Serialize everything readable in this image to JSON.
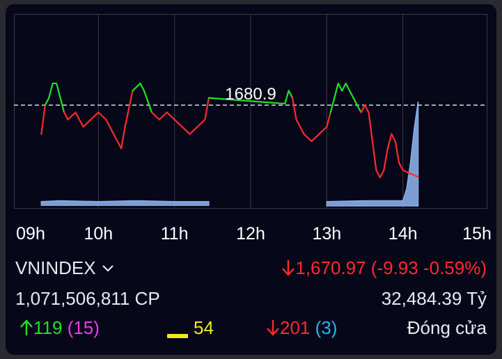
{
  "chart_data": {
    "type": "line",
    "reference_label": "1680.9",
    "reference_value": 1680.9,
    "x_tick_labels": [
      "09h",
      "10h",
      "11h",
      "12h",
      "13h",
      "14h",
      "15h"
    ],
    "series": [
      {
        "values": [
          [
            0.25,
            -4
          ],
          [
            0.3,
            0
          ],
          [
            0.35,
            1
          ],
          [
            0.4,
            3
          ],
          [
            0.45,
            3
          ],
          [
            0.5,
            1
          ],
          [
            0.55,
            -1
          ],
          [
            0.6,
            -2
          ],
          [
            0.7,
            -1
          ],
          [
            0.8,
            -3
          ],
          [
            0.9,
            -2
          ],
          [
            1.0,
            -1
          ],
          [
            1.1,
            -2
          ],
          [
            1.2,
            -4
          ],
          [
            1.3,
            -6
          ],
          [
            1.35,
            -3
          ],
          [
            1.45,
            2
          ],
          [
            1.55,
            3
          ],
          [
            1.6,
            2
          ],
          [
            1.7,
            -1
          ],
          [
            1.8,
            -2
          ],
          [
            1.9,
            -1
          ],
          [
            2.0,
            -2
          ],
          [
            2.1,
            -3
          ],
          [
            2.2,
            -4
          ],
          [
            2.3,
            -3
          ],
          [
            2.4,
            -2
          ],
          [
            2.45,
            1
          ],
          [
            3.45,
            0.2
          ],
          [
            3.5,
            2
          ],
          [
            3.55,
            1
          ],
          [
            3.6,
            -2
          ],
          [
            3.7,
            -4
          ],
          [
            3.8,
            -5
          ],
          [
            3.9,
            -4
          ],
          [
            4.0,
            -3
          ],
          [
            4.05,
            -1
          ],
          [
            4.15,
            3
          ],
          [
            4.2,
            2
          ],
          [
            4.25,
            3
          ],
          [
            4.35,
            1
          ],
          [
            4.45,
            -1
          ],
          [
            4.5,
            0
          ],
          [
            4.55,
            -1
          ],
          [
            4.6,
            -5
          ],
          [
            4.65,
            -9
          ],
          [
            4.7,
            -10
          ],
          [
            4.75,
            -9
          ],
          [
            4.8,
            -6
          ],
          [
            4.85,
            -4
          ],
          [
            4.9,
            -5
          ],
          [
            4.95,
            -8
          ],
          [
            5.0,
            -9
          ],
          [
            5.1,
            -9.5
          ],
          [
            5.2,
            -9.93
          ]
        ]
      }
    ],
    "volume": [
      [
        0.25,
        0.5
      ],
      [
        0.5,
        0.6
      ],
      [
        1.0,
        0.5
      ],
      [
        1.5,
        0.6
      ],
      [
        2.0,
        0.5
      ],
      [
        2.45,
        0.5
      ],
      [
        4.0,
        0.5
      ],
      [
        4.5,
        0.6
      ],
      [
        5.0,
        0.6
      ],
      [
        5.05,
        2
      ],
      [
        5.1,
        5
      ],
      [
        5.15,
        9
      ],
      [
        5.2,
        12
      ]
    ]
  },
  "footer": {
    "index_name": "VNINDEX",
    "index_value": "1,670.97 (-9.93 -0.59%)",
    "volume": "1,071,506,811 CP",
    "value": "32,484.39 Tỷ",
    "advances": "119",
    "advances_ceiling": "(15)",
    "unchanged": "54",
    "declines": "201",
    "declines_floor": "(3)",
    "status": "Đóng cửa"
  },
  "colors": {
    "up": "#22e222",
    "down": "#ff2a2a",
    "reference": "#ffffff",
    "volume": "#8aaee6",
    "ceiling": "#ea3ce8",
    "unchanged": "#f2ec1a",
    "floor": "#22b8f0"
  }
}
